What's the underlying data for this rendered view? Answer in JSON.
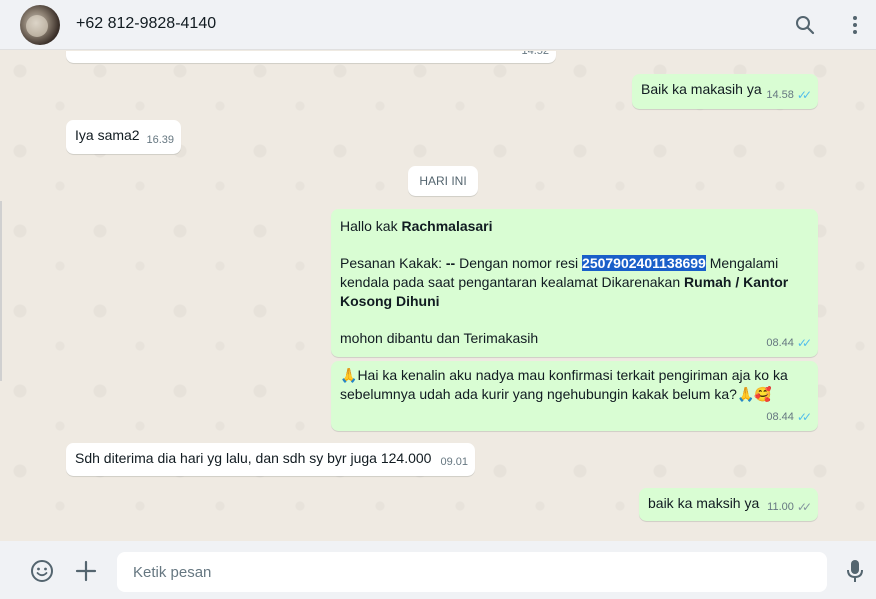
{
  "header": {
    "contact_name": "+62 812-9828-4140"
  },
  "messages": {
    "m0": {
      "time": "14.52"
    },
    "m1": {
      "text": "Baik ka makasih ya",
      "time": "14.58"
    },
    "m2": {
      "text": "Iya sama2",
      "time": "16.39"
    },
    "date_divider": "HARI INI",
    "m3": {
      "greeting": "Hallo kak ",
      "name": "Rachmalasari",
      "line2_a": "Pesanan Kakak: ",
      "line2_b": "--",
      "line2_c": " Dengan nomor resi ",
      "resi": "2507902401138699",
      "line2_d": " Mengalami kendala pada saat pengantaran kealamat Dikarenakan ",
      "reason": "Rumah / Kantor Kosong Dihuni",
      "closing": " mohon dibantu dan Terimakasih",
      "time": "08.44"
    },
    "m4": {
      "text": "Hai ka kenalin aku nadya mau konfirmasi terkait pengiriman aja ko ka sebelumnya udah ada kurir yang ngehubungin kakak belum ka?",
      "time": "08.44"
    },
    "m5": {
      "text": "Sdh diterima dia hari yg lalu, dan sdh sy byr juga 124.000",
      "time": "09.01"
    },
    "m6": {
      "text": "baik ka maksih ya",
      "time": "11.00"
    }
  },
  "composer": {
    "placeholder": "Ketik pesan"
  },
  "icons": {
    "search": "search-icon",
    "menu": "kebab-menu-icon",
    "emoji": "emoji-icon",
    "attach": "plus-icon",
    "mic": "microphone-icon"
  },
  "colors": {
    "outgoing": "#d9fdd3",
    "incoming": "#ffffff",
    "read_ticks": "#53bdeb",
    "highlight": "#1a5fc9"
  }
}
